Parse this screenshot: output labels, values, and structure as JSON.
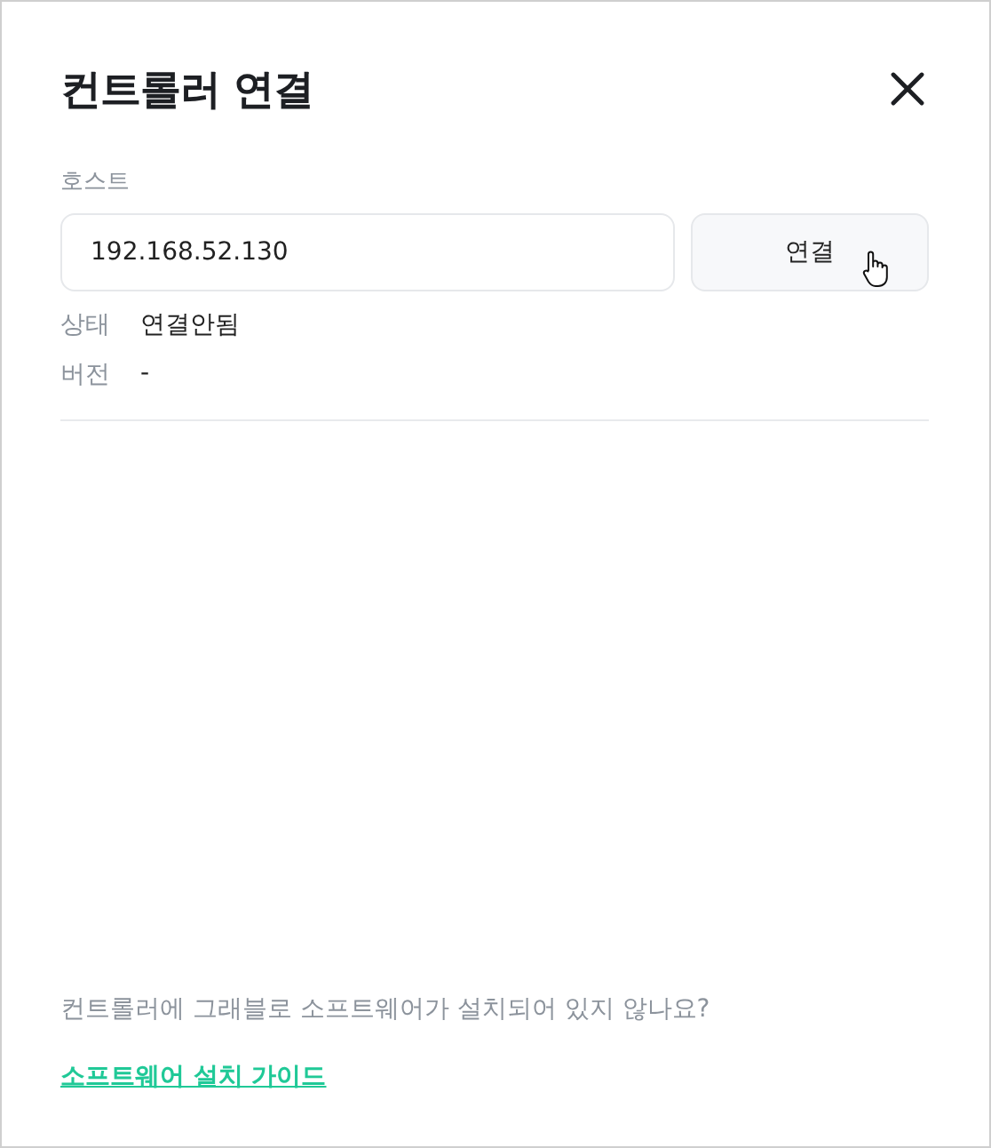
{
  "dialog": {
    "title": "컨트롤러 연결"
  },
  "host": {
    "label": "호스트",
    "value": "192.168.52.130",
    "button": "연결"
  },
  "info": [
    {
      "label": "상태",
      "value": "연결안됨"
    },
    {
      "label": "버전",
      "value": "-"
    }
  ],
  "footer": {
    "question": "컨트롤러에 그래블로 소프트웨어가 설치되어 있지 않나요?",
    "link": "소프트웨어 설치 가이드"
  }
}
